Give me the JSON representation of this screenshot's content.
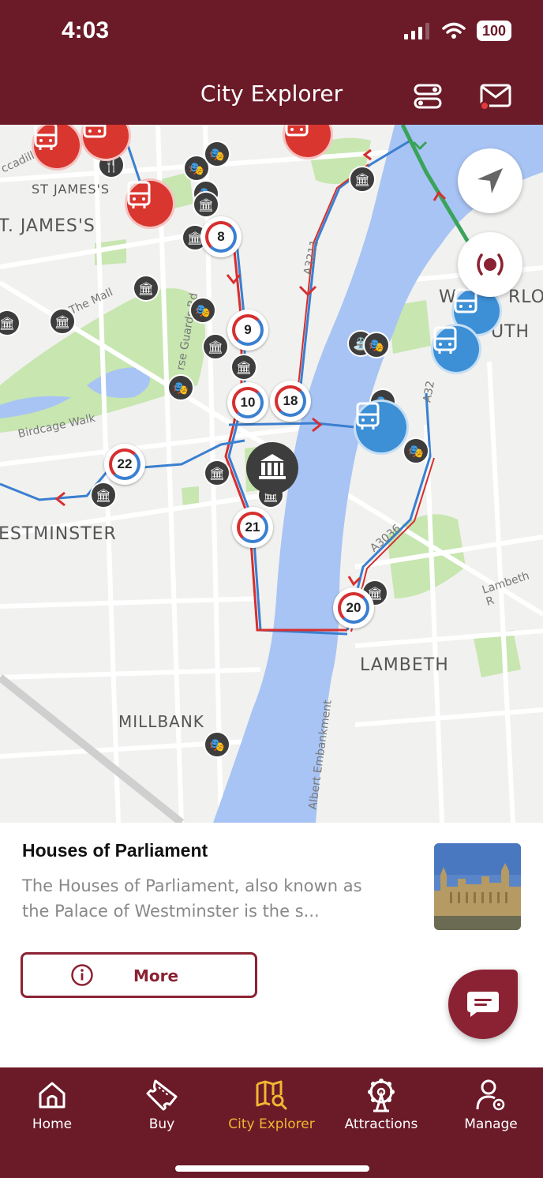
{
  "status_bar": {
    "time": "4:03",
    "battery": "100"
  },
  "header": {
    "title": "City Explorer",
    "filter_icon": "filter-toggle-icon",
    "mail_icon": "mail-icon"
  },
  "map": {
    "area_labels": {
      "st_james_small": "ST JAMES'S",
      "st_james_large": "T. JAMES'S",
      "westminster": "ESTMINSTER",
      "lambeth": "LAMBETH",
      "millbank": "MILLBANK",
      "waterloo": "W",
      "waterloo_tail": "RLO",
      "south": "UTH"
    },
    "road_labels": {
      "piccadilly": "ccadilly",
      "the_mall": "The Mall",
      "horse_guards": "rse Guards Rd",
      "birdcage": "Birdcage Walk",
      "a3211": "A3211",
      "a3036": "A3036",
      "a32": "A32",
      "lambeth_rd": "Lambeth R",
      "albert_emb": "Albert Embankment"
    },
    "stops": [
      "8",
      "9",
      "10",
      "18",
      "22",
      "21",
      "20"
    ],
    "colors": {
      "water": "#a8c4f4",
      "park": "#c7e6b0",
      "route_red": "#d62f2f",
      "route_blue": "#3a7fd0",
      "route_green": "#3aa35a"
    }
  },
  "card": {
    "title": "Houses of Parliament",
    "description": "The Houses of Parliament, also known as the Palace of Westminster is the s...",
    "more_label": "More"
  },
  "tabs": [
    {
      "label": "Home",
      "icon": "home-icon"
    },
    {
      "label": "Buy",
      "icon": "ticket-icon"
    },
    {
      "label": "City Explorer",
      "icon": "map-search-icon",
      "active": true
    },
    {
      "label": "Attractions",
      "icon": "ferris-wheel-icon"
    },
    {
      "label": "Manage",
      "icon": "user-settings-icon"
    }
  ]
}
